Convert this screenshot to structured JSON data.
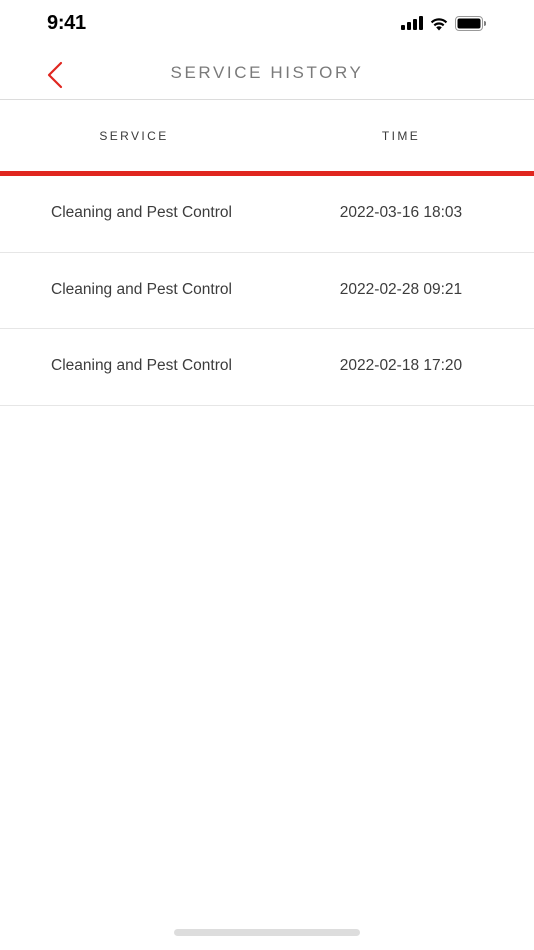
{
  "status_bar": {
    "time": "9:41"
  },
  "nav": {
    "title": "SERVICE HISTORY",
    "accent_color": "#e0261f"
  },
  "table": {
    "columns": {
      "service": "SERVICE",
      "time": "TIME"
    },
    "rows": [
      {
        "service": "Cleaning and Pest Control",
        "time": "2022-03-16 18:03"
      },
      {
        "service": "Cleaning and Pest Control",
        "time": "2022-02-28 09:21"
      },
      {
        "service": "Cleaning and Pest Control",
        "time": "2022-02-18 17:20"
      }
    ]
  }
}
